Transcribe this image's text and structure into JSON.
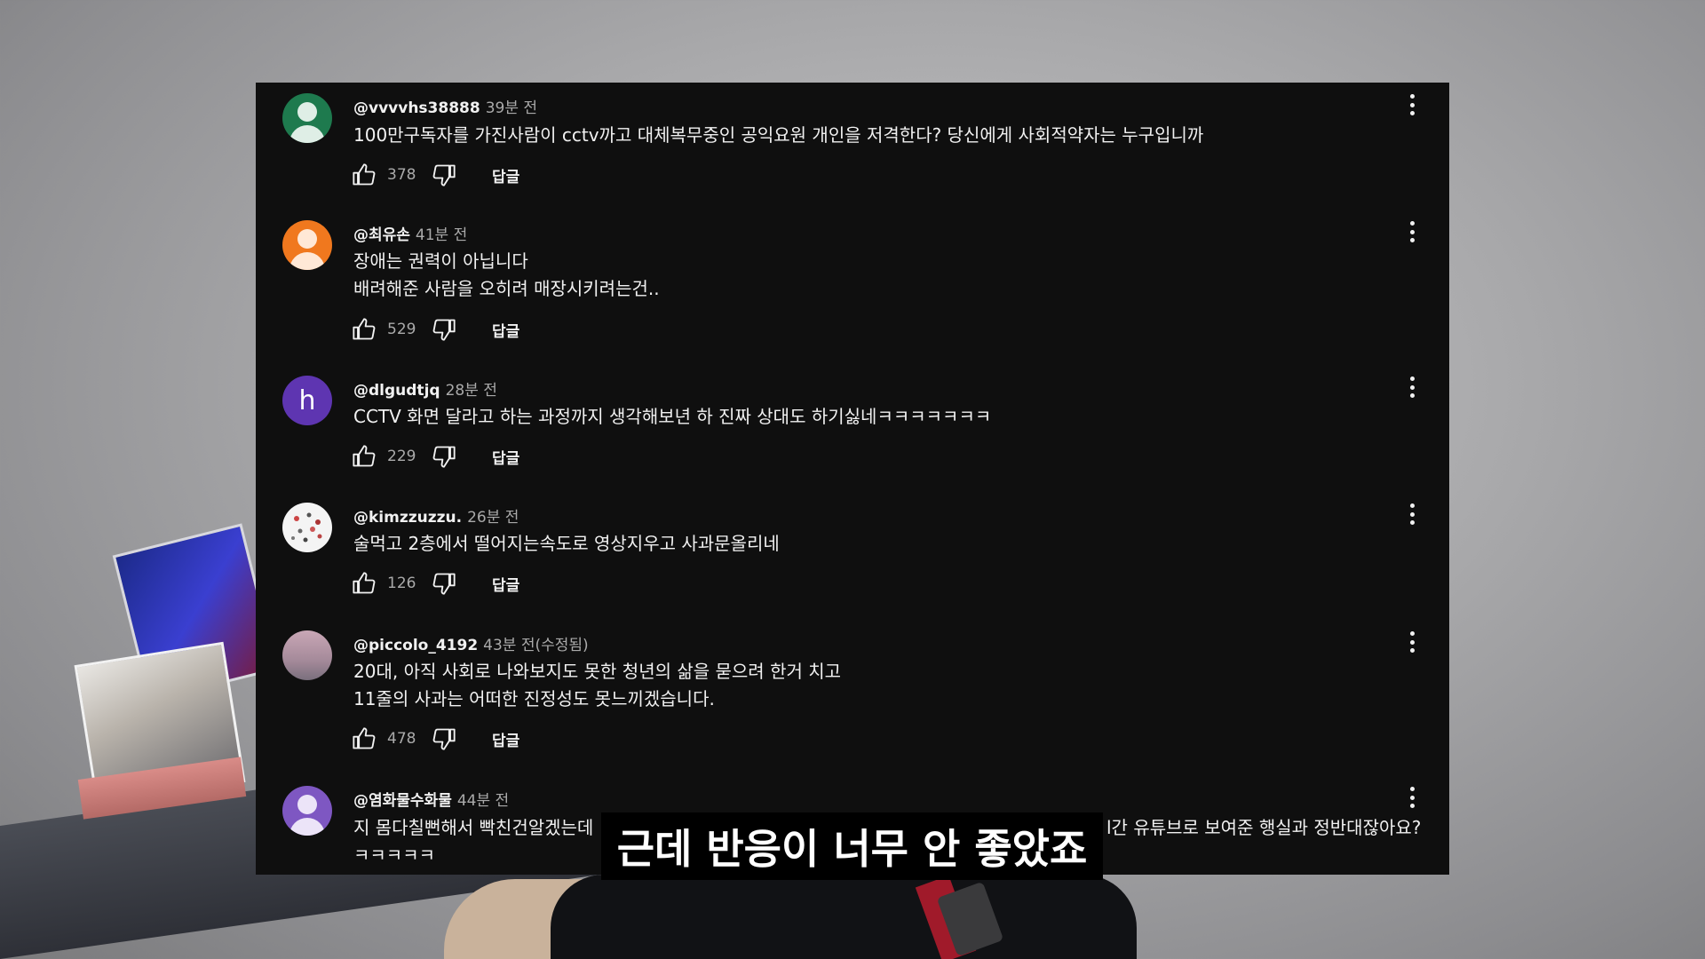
{
  "comments": [
    {
      "username": "@vvvvhs38888",
      "time": "39분 전",
      "avatar_color": "#1e7a4e",
      "avatar_type": "person",
      "lines": [
        "100만구독자를 가진사람이 cctv까고 대체복무중인 공익요원 개인을 저격한다? 당신에게 사회적약자는 누구입니까"
      ],
      "likes": "378",
      "reply": "답글"
    },
    {
      "username": "@최유손",
      "time": "41분 전",
      "avatar_color": "#f0781e",
      "avatar_type": "person",
      "lines": [
        "장애는 권력이 아닙니다",
        "배려해준 사람을 오히려 매장시키려는건.."
      ],
      "likes": "529",
      "reply": "답글"
    },
    {
      "username": "@dlgudtjq",
      "time": "28분 전",
      "avatar_color": "#5e35b1",
      "avatar_type": "letter",
      "avatar_letter": "h",
      "lines": [
        "CCTV 화면 달라고 하는 과정까지 생각해보년 하 진짜 상대도 하기싫네ㅋㅋㅋㅋㅋㅋㅋ"
      ],
      "likes": "229",
      "reply": "답글"
    },
    {
      "username": "@kimzzuzzu.",
      "time": "26분 전",
      "avatar_color": "#f4f4f4",
      "avatar_type": "dots",
      "lines": [
        "술먹고 2층에서 떨어지는속도로 영상지우고 사과문올리네"
      ],
      "likes": "126",
      "reply": "답글"
    },
    {
      "username": "@piccolo_4192",
      "time": "43분 전(수정됨)",
      "avatar_color": "#b79aa4",
      "avatar_type": "photo",
      "lines": [
        "20대, 아직 사회로 나와보지도 못한 청년의 삶을 묻으려 한거 치고",
        "11줄의 사과는 어떠한 진정성도 못느끼겠습니다."
      ],
      "likes": "478",
      "reply": "답글"
    },
    {
      "username": "@염화물수화물",
      "time": "44분 전",
      "avatar_color": "#7e57c2",
      "avatar_type": "person",
      "lines": [
        "지 몸다칠뻔해서 빡친건알겠는데",
        "ㅋㅋㅋㅋㅋ"
      ],
      "lines_right": "l간 유튜브로 보여준 행실과 정반대잖아요?"
    }
  ],
  "subtitle": "근데 반응이 너무 안 좋았죠"
}
